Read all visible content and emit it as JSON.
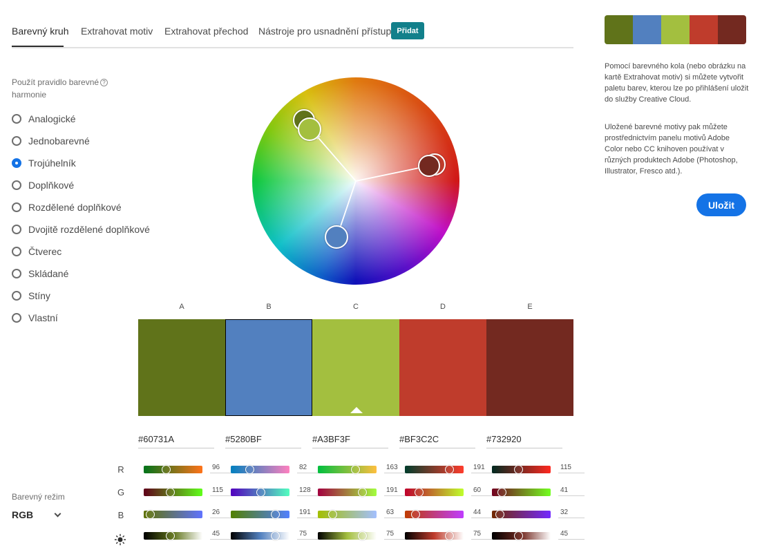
{
  "tabs": [
    {
      "label": "Barevný kruh",
      "active": true
    },
    {
      "label": "Extrahovat motiv"
    },
    {
      "label": "Extrahovat přechod"
    },
    {
      "label": "Nástroje pro usnadnění přístupu"
    }
  ],
  "add_button": "Přidat",
  "harmony": {
    "title": "Použít pravidlo barevné harmonie",
    "help_icon": "question-mark-icon",
    "rules": [
      {
        "label": "Analogické",
        "checked": false
      },
      {
        "label": "Jednobarevné",
        "checked": false
      },
      {
        "label": "Trojúhelník",
        "checked": true
      },
      {
        "label": "Doplňkové",
        "checked": false
      },
      {
        "label": "Rozdělené doplňkové",
        "checked": false
      },
      {
        "label": "Dvojitě rozdělené doplňkové",
        "checked": false
      },
      {
        "label": "Čtverec",
        "checked": false
      },
      {
        "label": "Skládané",
        "checked": false
      },
      {
        "label": "Stíny",
        "checked": false
      },
      {
        "label": "Vlastní",
        "checked": false
      }
    ]
  },
  "color_mode": {
    "label": "Barevný režim",
    "value": "RGB"
  },
  "swatches": [
    {
      "letter": "A",
      "hex": "#60731A",
      "color": "#60731A",
      "selected": false,
      "r": 96,
      "g": 115,
      "b": 26,
      "brightness": 45
    },
    {
      "letter": "B",
      "hex": "#5280BF",
      "color": "#5280BF",
      "selected": true,
      "r": 82,
      "g": 128,
      "b": 191,
      "brightness": 75
    },
    {
      "letter": "C",
      "hex": "#A3BF3F",
      "color": "#A3BF3F",
      "selected": false,
      "base": true,
      "r": 163,
      "g": 191,
      "b": 63,
      "brightness": 75
    },
    {
      "letter": "D",
      "hex": "#BF3C2C",
      "color": "#BF3C2C",
      "selected": false,
      "r": 191,
      "g": 60,
      "b": 44,
      "brightness": 75
    },
    {
      "letter": "E",
      "hex": "#732920",
      "color": "#732920",
      "selected": false,
      "r": 115,
      "g": 41,
      "b": 32,
      "brightness": 45
    }
  ],
  "channels": {
    "r": "R",
    "g": "G",
    "b": "B",
    "brightness_icon": "sun-icon"
  },
  "side_panel": {
    "paragraph1": "Pomocí barevného kola (nebo obrázku na kartě Extrahovat motiv) si můžete vytvořit paletu barev, kterou lze po přihlášení uložit do služby Creative Cloud.",
    "paragraph2": "Uložené barevné motivy pak můžete prostřednictvím panelu motivů Adobe Color nebo CC knihoven používat v různých produktech Adobe (Photoshop, Illustrator, Fresco atd.).",
    "save_button": "Uložit"
  }
}
